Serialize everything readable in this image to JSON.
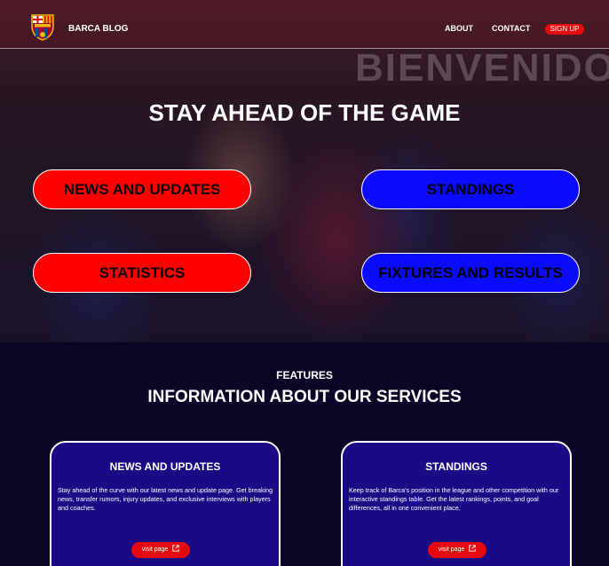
{
  "nav": {
    "brand": "BARCA BLOG",
    "about": "ABOUT",
    "contact": "CONTACT",
    "signup": "SIGN UP"
  },
  "hero": {
    "banner": "BIENVENIDO",
    "title": "STAY AHEAD OF THE GAME",
    "buttons": [
      "NEWS AND UPDATES",
      "STANDINGS",
      "STATISTICS",
      "FIXTURES AND RESULTS"
    ]
  },
  "features": {
    "label": "FEATURES",
    "heading": "INFORMATION ABOUT OUR SERVICES",
    "cards": [
      {
        "title": "NEWS AND UPDATES",
        "description": "Stay ahead of the curve with our latest news and update page. Get breaking news, transfer rumors, injury updates, and exclusive interviews with players and coaches.",
        "link": "visit page"
      },
      {
        "title": "STANDINGS",
        "description": "Keep track of Barca's position in the league and other competition with our interactive standings table. Get the latest rankings, points, and goal differences, all in one convenient place.",
        "link": "visit page"
      }
    ]
  },
  "colors": {
    "red": "#ff0000",
    "blue": "#0a0aff",
    "card": "#1a0a85",
    "background": "#0b0528",
    "signup": "#e8090c"
  },
  "icons": [
    "barca-crest-icon",
    "external-link-icon"
  ]
}
